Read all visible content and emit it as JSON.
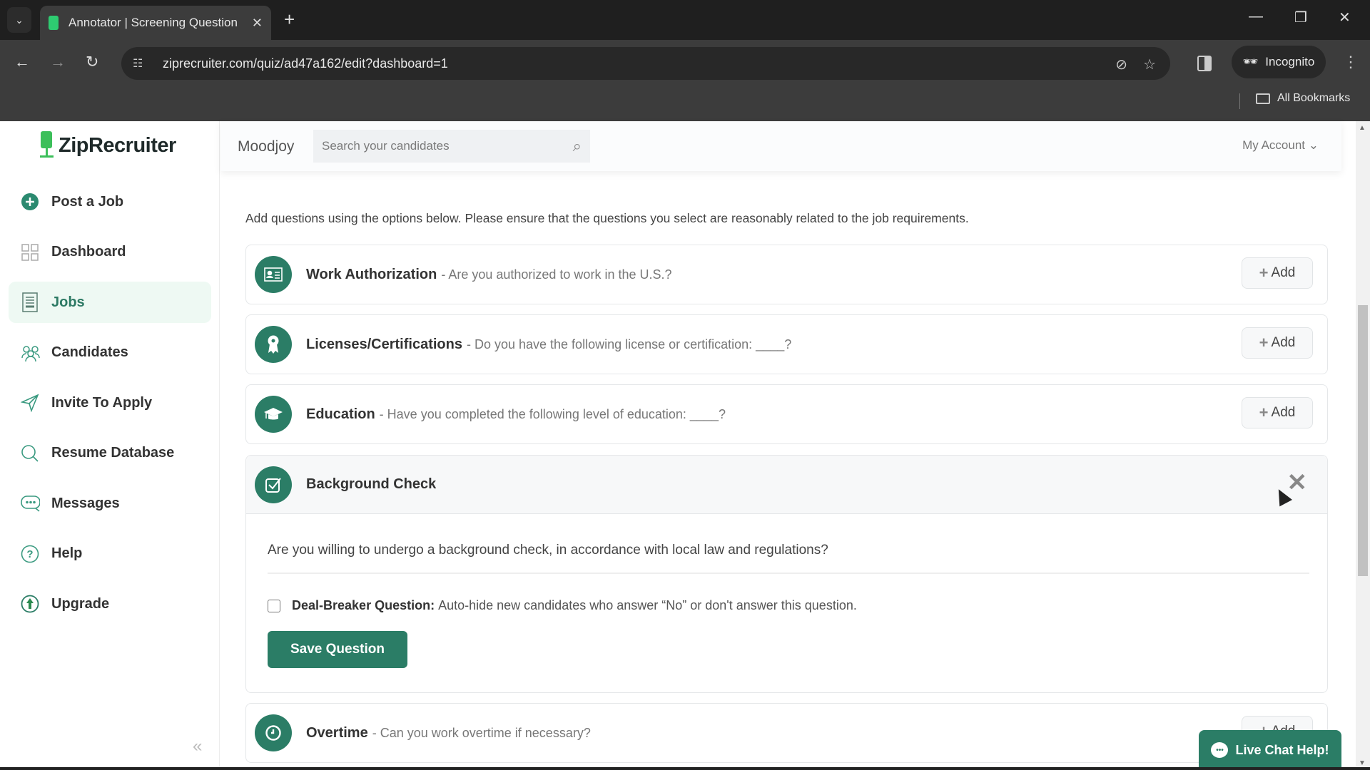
{
  "browser": {
    "tab_title": "Annotator | Screening Question",
    "url": "ziprecruiter.com/quiz/ad47a162/edit?dashboard=1",
    "incognito_label": "Incognito",
    "bookmarks_label": "All Bookmarks"
  },
  "app": {
    "logo_text": "ZipRecruiter",
    "company_name": "Moodjoy",
    "search_placeholder": "Search your candidates",
    "account_label": "My Account",
    "accent_color": "#2b7d66"
  },
  "sidebar": {
    "items": [
      {
        "label": "Post a Job",
        "icon": "plus-circle-icon",
        "active": false
      },
      {
        "label": "Dashboard",
        "icon": "grid-icon",
        "active": false
      },
      {
        "label": "Jobs",
        "icon": "document-icon",
        "active": true
      },
      {
        "label": "Candidates",
        "icon": "people-icon",
        "active": false
      },
      {
        "label": "Invite To Apply",
        "icon": "send-icon",
        "active": false
      },
      {
        "label": "Resume Database",
        "icon": "search-icon",
        "active": false
      },
      {
        "label": "Messages",
        "icon": "chat-icon",
        "active": false
      },
      {
        "label": "Help",
        "icon": "help-icon",
        "active": false
      },
      {
        "label": "Upgrade",
        "icon": "upgrade-icon",
        "active": false
      }
    ]
  },
  "main": {
    "intro": "Add questions using the options below. Please ensure that the questions you select are reasonably related to the job requirements.",
    "add_label": "Add",
    "questions": [
      {
        "title": "Work Authorization",
        "desc": "- Are you authorized to work in the U.S.?",
        "icon": "id-card-icon"
      },
      {
        "title": "Licenses/Certifications",
        "desc": "- Do you have the following license or certification: ____?",
        "icon": "ribbon-icon"
      },
      {
        "title": "Education",
        "desc": "- Have you completed the following level of education: ____?",
        "icon": "graduation-cap-icon"
      }
    ],
    "expanded": {
      "title": "Background Check",
      "question": "Are you willing to undergo a background check, in accordance with local law and regulations?",
      "dealbreaker_label": "Deal-Breaker Question:",
      "dealbreaker_text": "Auto-hide new candidates who answer “No” or don't answer this question.",
      "dealbreaker_checked": false,
      "save_label": "Save Question"
    },
    "next_question": {
      "title": "Overtime",
      "desc": "- Can you work overtime if necessary?"
    }
  },
  "chat": {
    "label": "Live Chat Help!"
  }
}
